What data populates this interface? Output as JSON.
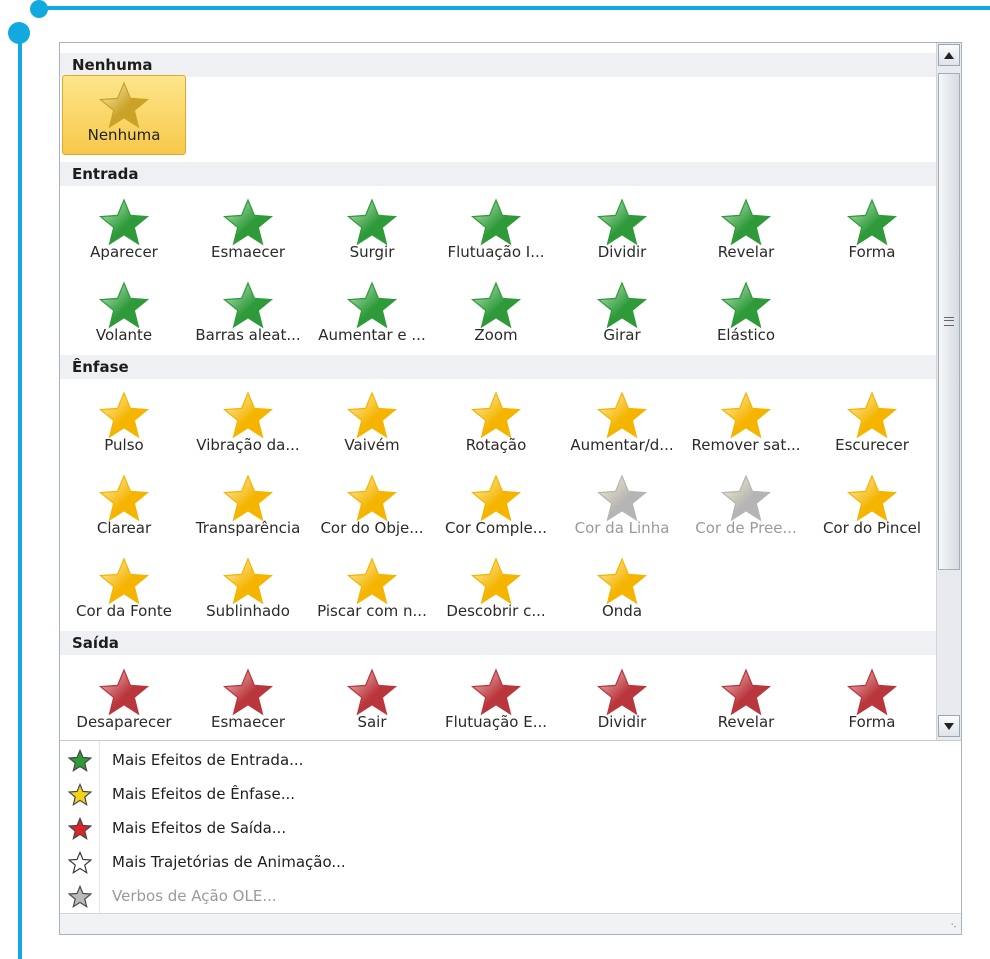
{
  "sections": [
    {
      "id": "nenhuma",
      "title": "Nenhuma",
      "items": [
        {
          "label": "Nenhuma",
          "icon": "star-none-icon",
          "selected": true
        }
      ]
    },
    {
      "id": "entrada",
      "title": "Entrada",
      "items": [
        {
          "label": "Aparecer",
          "icon": "appear-star-icon"
        },
        {
          "label": "Esmaecer",
          "icon": "fade-star-icon"
        },
        {
          "label": "Surgir",
          "icon": "fly-in-star-icon"
        },
        {
          "label": "Flutuação I...",
          "icon": "float-in-star-icon"
        },
        {
          "label": "Dividir",
          "icon": "split-star-icon"
        },
        {
          "label": "Revelar",
          "icon": "wipe-star-icon"
        },
        {
          "label": "Forma",
          "icon": "shape-star-icon"
        },
        {
          "label": "Volante",
          "icon": "wheel-star-icon"
        },
        {
          "label": "Barras aleat...",
          "icon": "random-bars-star-icon"
        },
        {
          "label": "Aumentar e ...",
          "icon": "grow-turn-star-icon"
        },
        {
          "label": "Zoom",
          "icon": "zoom-star-icon"
        },
        {
          "label": "Girar",
          "icon": "swivel-star-icon"
        },
        {
          "label": "Elástico",
          "icon": "bounce-star-icon"
        }
      ]
    },
    {
      "id": "enfase",
      "title": "Ênfase",
      "items": [
        {
          "label": "Pulso",
          "icon": "pulse-star-icon"
        },
        {
          "label": "Vibração da...",
          "icon": "color-pulse-star-icon"
        },
        {
          "label": "Vaivém",
          "icon": "teeter-star-icon"
        },
        {
          "label": "Rotação",
          "icon": "spin-star-icon"
        },
        {
          "label": "Aumentar/d...",
          "icon": "grow-shrink-star-icon"
        },
        {
          "label": "Remover sat...",
          "icon": "desaturate-star-icon"
        },
        {
          "label": "Escurecer",
          "icon": "darken-star-icon"
        },
        {
          "label": "Clarear",
          "icon": "lighten-star-icon"
        },
        {
          "label": "Transparência",
          "icon": "transparency-star-icon"
        },
        {
          "label": "Cor do Obje...",
          "icon": "object-color-star-icon"
        },
        {
          "label": "Cor Comple...",
          "icon": "complementary-color-star-icon"
        },
        {
          "label": "Cor da Linha",
          "icon": "line-color-star-icon",
          "disabled": true
        },
        {
          "label": "Cor de Pree...",
          "icon": "fill-color-star-icon",
          "disabled": true
        },
        {
          "label": "Cor do Pincel",
          "icon": "brush-color-star-icon"
        },
        {
          "label": "Cor da Fonte",
          "icon": "font-color-star-icon"
        },
        {
          "label": "Sublinhado",
          "icon": "underline-star-icon"
        },
        {
          "label": "Piscar com n...",
          "icon": "bold-flash-star-icon"
        },
        {
          "label": "Descobrir c...",
          "icon": "bold-reveal-star-icon"
        },
        {
          "label": "Onda",
          "icon": "wave-star-icon"
        }
      ]
    },
    {
      "id": "saida",
      "title": "Saída",
      "items": [
        {
          "label": "Desaparecer",
          "icon": "disappear-star-icon"
        },
        {
          "label": "Esmaecer",
          "icon": "fade-out-star-icon"
        },
        {
          "label": "Sair",
          "icon": "fly-out-star-icon"
        },
        {
          "label": "Flutuação E...",
          "icon": "float-out-star-icon"
        },
        {
          "label": "Dividir",
          "icon": "split-out-star-icon"
        },
        {
          "label": "Revelar",
          "icon": "wipe-out-star-icon"
        },
        {
          "label": "Forma",
          "icon": "shape-out-star-icon"
        }
      ]
    }
  ],
  "menu": [
    {
      "label": "Mais Efeitos de Entrada...",
      "icon": "green-star-icon"
    },
    {
      "label": "Mais Efeitos de Ênfase...",
      "icon": "yellow-star-icon"
    },
    {
      "label": "Mais Efeitos de Saída...",
      "icon": "red-star-icon"
    },
    {
      "label": "Mais Trajetórias de Animação...",
      "icon": "outline-star-icon"
    },
    {
      "label": "Verbos de Ação OLE...",
      "icon": "ole-verb-icon",
      "disabled": true
    }
  ],
  "colors": {
    "accent": "#12a9e0",
    "entrada_green": "#2e9a3a",
    "enfase_gold": "#f4b400",
    "saida_red": "#b9363c",
    "disabled_grey": "#b5b5b5",
    "none_gold": "#c9a227"
  }
}
